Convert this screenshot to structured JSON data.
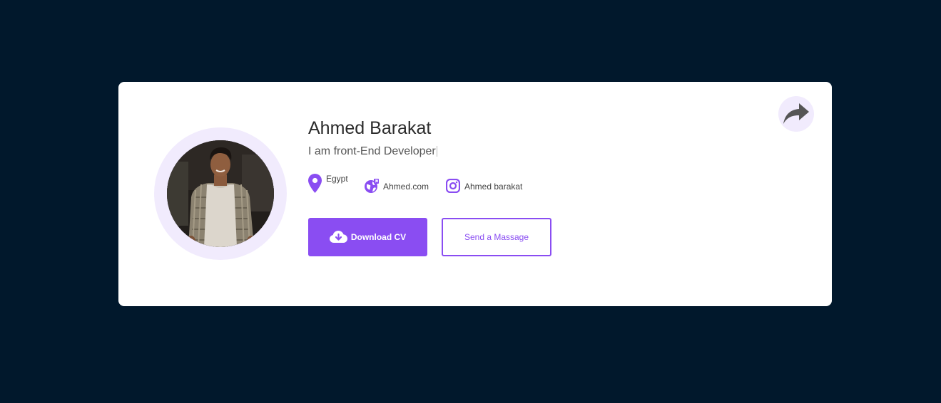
{
  "profile": {
    "name": "Ahmed Barakat",
    "role": "I am front-End Developer"
  },
  "contacts": {
    "location": {
      "label": "Egypt",
      "icon": "map-pin-icon"
    },
    "website": {
      "label": "Ahmed.com",
      "icon": "globe-icon"
    },
    "instagram": {
      "label": "Ahmed barakat",
      "icon": "instagram-icon"
    }
  },
  "actions": {
    "download_label": "Download CV",
    "download_icon": "cloud-download-icon",
    "message_label": "Send a Massage"
  },
  "share": {
    "icon": "share-arrow-icon"
  },
  "colors": {
    "background": "#01182c",
    "card": "#ffffff",
    "accent": "#8a4df2",
    "accent_light": "#f1ebfd",
    "share_icon": "#555555"
  }
}
